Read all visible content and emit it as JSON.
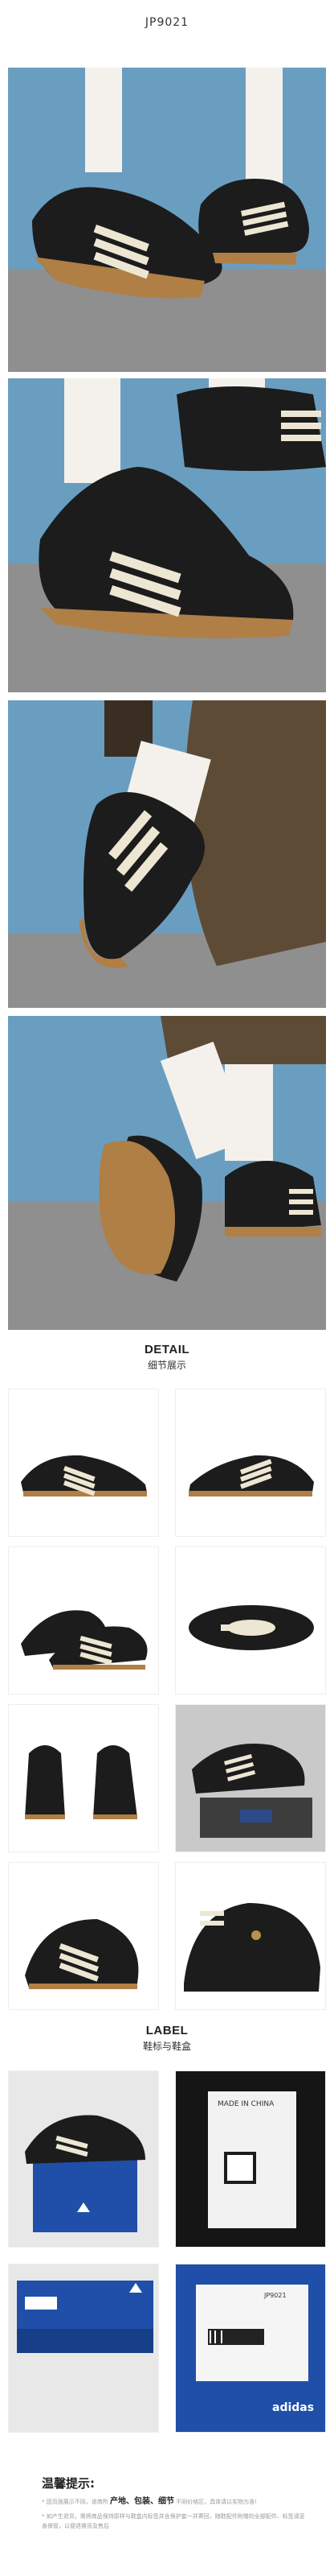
{
  "header": {
    "product_code": "JP9021"
  },
  "detail": {
    "title_en": "DETAIL",
    "title_cn": "细节展示"
  },
  "label": {
    "title_en": "LABEL",
    "title_cn": "鞋标与鞋盒"
  },
  "box_labels": {
    "made_in": "MADE IN CHINA",
    "brand": "adidas",
    "code_small": "JP9021"
  },
  "tips": {
    "title": "温馨提示:",
    "line1_pre": "* 因页面展示不同，该商所 ",
    "line1_b1": "产地、",
    "line1_b2": "包装、",
    "line1_b3": "细节",
    "line1_post": " 不同价格区，具体请以实物为准!",
    "line2": "* 如产生退货，需将商品保持原样与鞋盒内标签并含保护套一并寄回，随鞋配件附赠的全部配件、标签请妥善保管，以便退换货及售后"
  },
  "colors": {
    "shoe": "#1c1c1c",
    "stripe": "#ede6d3",
    "gum": "#b07f45",
    "sky": "#6a9ec0",
    "ground": "#8f8f8f",
    "box_blue": "#1f4fa8"
  }
}
